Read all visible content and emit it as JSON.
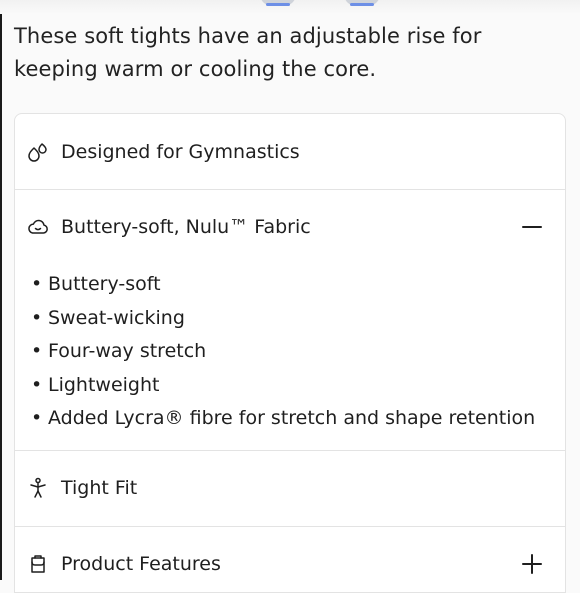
{
  "product": {
    "description": "These soft tights have an adjustable rise for keeping warm or cooling the core."
  },
  "accordion": {
    "items": [
      {
        "title": "Designed for Gymnastics",
        "icon": "drops-icon",
        "expanded": false,
        "show_toggle": false
      },
      {
        "title": "Buttery-soft, Nulu™ Fabric",
        "icon": "cloud-smile-icon",
        "expanded": true,
        "toggle": "minus",
        "bullets": [
          "Buttery-soft",
          "Sweat-wicking",
          "Four-way stretch",
          "Lightweight",
          "Added Lycra® fibre for stretch and shape retention"
        ]
      },
      {
        "title": "Tight Fit",
        "icon": "fit-figure-icon",
        "expanded": false,
        "show_toggle": false
      },
      {
        "title": "Product Features",
        "icon": "features-icon",
        "expanded": false,
        "toggle": "plus"
      }
    ]
  },
  "colors": {
    "text": "#1f1f1f",
    "divider": "#e3e3e3",
    "background": "#fafafa",
    "card": "#ffffff"
  }
}
